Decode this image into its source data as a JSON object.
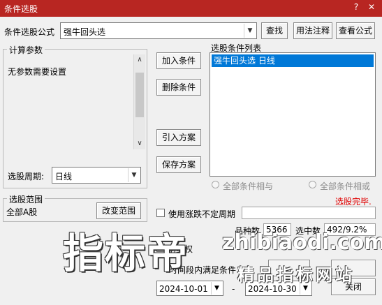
{
  "window": {
    "title": "条件选股"
  },
  "formula": {
    "label": "条件选股公式",
    "value": "强牛回头选"
  },
  "buttons": {
    "find": "查找",
    "usage": "用法注释",
    "view_formula": "查看公式",
    "add_condition": "加入条件",
    "delete_condition": "删除条件",
    "import_scheme": "引入方案",
    "save_scheme": "保存方案",
    "change_range": "改变范围",
    "close": "关闭"
  },
  "params": {
    "legend": "计算参数",
    "text": "无参数需要设置"
  },
  "period": {
    "label": "选股周期:",
    "value": "日线"
  },
  "condition_list": {
    "label": "选股条件列表",
    "items": [
      "强牛回头选  日线"
    ]
  },
  "logic": {
    "and_label": "全部条件相与",
    "or_label": "全部条件相或"
  },
  "status": {
    "done": "选股完毕.",
    "color": "#e00000"
  },
  "range": {
    "legend": "选股范围",
    "value": "全部A股"
  },
  "volatile_period": {
    "label": "使用涨跌不定周期"
  },
  "stats": {
    "count_label": "品种数",
    "count": "5366",
    "selected_label": "选中数",
    "selected": "492/9.2%"
  },
  "options": {
    "adjust_label": "前复权",
    "time_label": "时间段内满足条件"
  },
  "dates": {
    "start": "2024-10-01",
    "separator": "-",
    "end": "2024-10-30"
  },
  "watermark": {
    "text": "指标帝",
    "site": "zhibiaodi.com",
    "slogan": "精品指标网站"
  }
}
